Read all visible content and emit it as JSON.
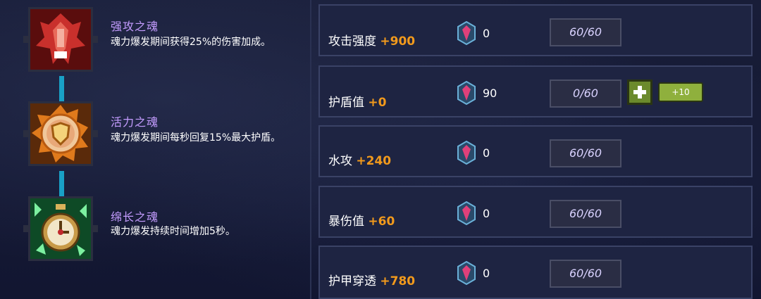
{
  "skills": [
    {
      "name": "强攻之魂",
      "desc": "魂力爆发期间获得25%的伤害加成。",
      "icon": "claw-icon"
    },
    {
      "name": "活力之魂",
      "desc": "魂力爆发期间每秒回复15%最大护盾。",
      "icon": "shield-icon"
    },
    {
      "name": "绵长之魂",
      "desc": "魂力爆发持续时间增加5秒。",
      "icon": "stopwatch-icon"
    }
  ],
  "stats": [
    {
      "label": "攻击强度",
      "bonus": "+900",
      "gems": "0",
      "progress": "60/60"
    },
    {
      "label": "护盾值",
      "bonus": "+0",
      "gems": "90",
      "progress": "0/60",
      "plus_ten": "+10"
    },
    {
      "label": "水攻",
      "bonus": "+240",
      "gems": "0",
      "progress": "60/60"
    },
    {
      "label": "暴伤值",
      "bonus": "+60",
      "gems": "0",
      "progress": "60/60"
    },
    {
      "label": "护甲穿透",
      "bonus": "+780",
      "gems": "0",
      "progress": "60/60"
    }
  ],
  "colors": {
    "bonus": "#f29a1c",
    "skill_name": "#c49cff",
    "connector": "#19a0c6"
  }
}
